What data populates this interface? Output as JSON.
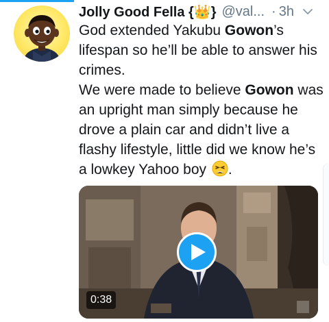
{
  "author": {
    "display_name": "Jolly Good Fella {👑}",
    "handle": "@val...",
    "separator": "·",
    "timestamp": "3h",
    "avatar_icon": "cartoon-boy-avatar"
  },
  "tweet": {
    "p1_a": "God extended Yakubu ",
    "p1_bold": "Gowon",
    "p1_b": "’s lifespan so he’ll be able to answer his crimes.",
    "p2_a": "We were made to believe ",
    "p2_bold": "Gowon",
    "p2_b": " was an upright man simply because he drove a plain car and didn’t live a flashy lifestyle, little did we know he’s a lowkey Yahoo boy ",
    "p2_end": ".",
    "emoji": "tired-face-emoji"
  },
  "media": {
    "duration": "0:38",
    "play_icon": "play-icon",
    "accent_color": "#1da1f2"
  },
  "menu_icon": "chevron-down-icon"
}
